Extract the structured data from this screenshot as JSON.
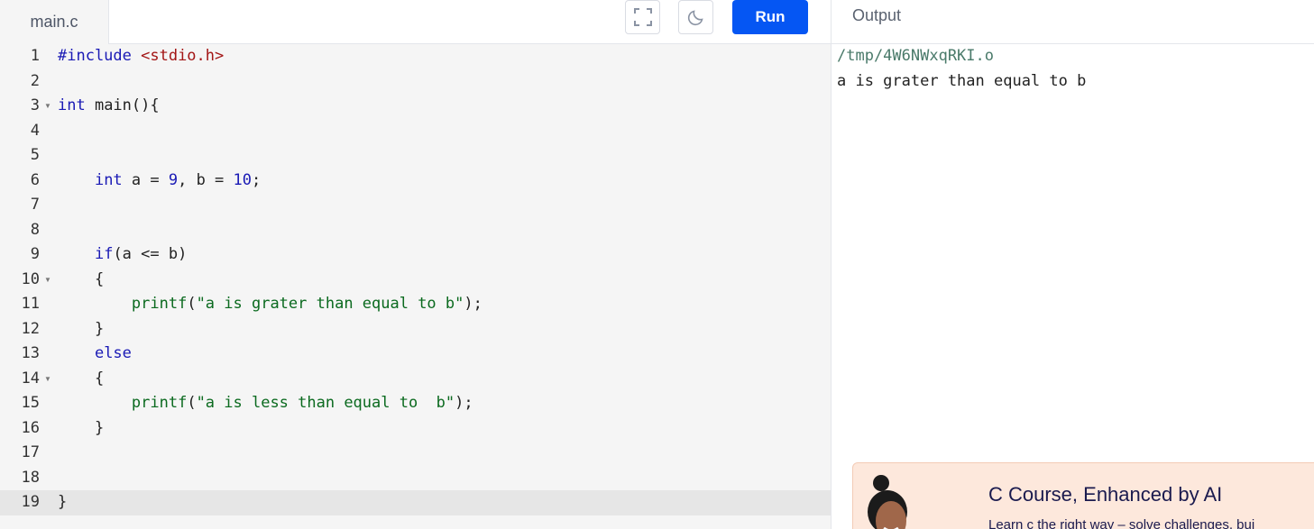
{
  "header": {
    "tab_label": "main.c",
    "fullscreen_icon": "fullscreen-icon",
    "theme_icon": "moon-icon",
    "run_label": "Run",
    "output_label": "Output"
  },
  "editor": {
    "line_numbers": [
      "1",
      "2",
      "3",
      "4",
      "5",
      "6",
      "7",
      "8",
      "9",
      "10",
      "11",
      "12",
      "13",
      "14",
      "15",
      "16",
      "17",
      "18",
      "19"
    ],
    "fold_lines": [
      "3",
      "10",
      "14"
    ],
    "lines": [
      "#include <stdio.h>",
      "",
      "int main(){",
      "",
      "",
      "    int a = 9, b = 10;",
      "",
      "",
      "    if(a <= b)",
      "    {",
      "        printf(\"a is grater than equal to b\");",
      "    }",
      "    else",
      "    {",
      "        printf(\"a is less than equal to  b\");",
      "    }",
      "",
      "",
      "}"
    ],
    "active_line": 19
  },
  "output": {
    "path": "/tmp/4W6NWxqRKI.o",
    "text": "a is grater than equal to b"
  },
  "promo": {
    "title": "C Course, Enhanced by AI",
    "subtitle": "Learn c the right way – solve challenges, bui"
  },
  "colors": {
    "run_button": "#0556f3",
    "keyword": "#1a1ab5",
    "string": "#0b6a1f",
    "include": "#a31515",
    "promo_bg": "#fde8dc"
  }
}
